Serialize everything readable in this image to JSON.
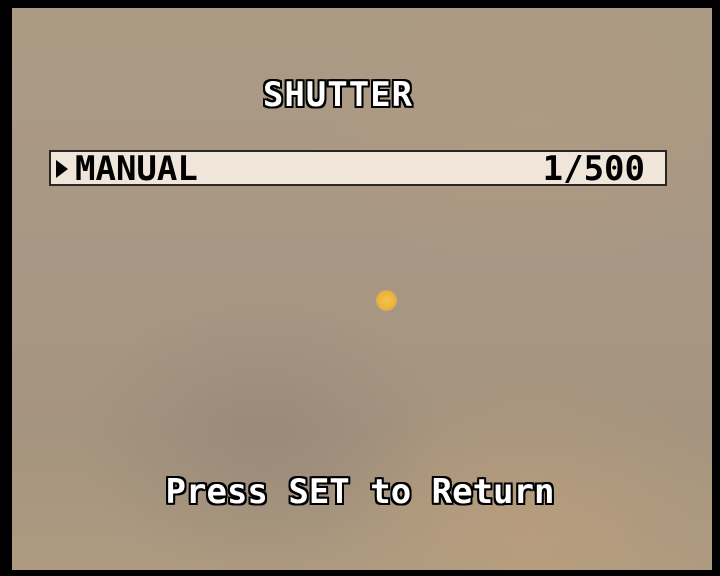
{
  "osd": {
    "title": "SHUTTER",
    "menu": {
      "items": [
        {
          "label": "MANUAL",
          "value": "1/500",
          "selected": true
        }
      ]
    },
    "hint": "Press SET to Return"
  },
  "colors": {
    "background_video": "#a89784",
    "row_highlight": "#efe5d8",
    "osd_text": "#ffffff",
    "osd_outline": "#000000",
    "sun": "#f4c24a"
  },
  "icons": {
    "selection_marker": "triangle-right-icon"
  }
}
